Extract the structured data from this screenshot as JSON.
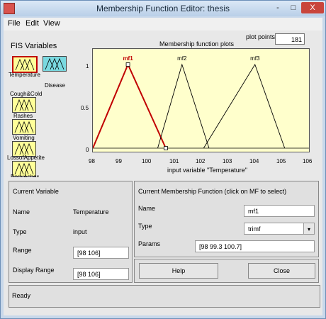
{
  "window": {
    "title": "Membership Function Editor: thesis",
    "minimize": "-",
    "maximize": "□",
    "close": "X"
  },
  "menu": [
    "File",
    "Edit",
    "View"
  ],
  "fis_variables": {
    "heading": "FIS Variables",
    "inputs": [
      "Temperature",
      "Cough&Cold",
      "Rashes",
      "Vomiting",
      "LossofAppetite",
      "BodyAches"
    ],
    "output": "Disease"
  },
  "plot": {
    "title": "Membership function plots",
    "plot_points_label": "plot points:",
    "plot_points_value": "181",
    "x_label": "input variable \"Temperature\"",
    "x_ticks": [
      "98",
      "99",
      "100",
      "101",
      "102",
      "103",
      "104",
      "105",
      "106"
    ],
    "y_ticks": [
      "1",
      "0.5",
      "0"
    ],
    "mf_labels": [
      "mf1",
      "mf2",
      "mf3"
    ],
    "colors": {
      "selected": "#c00000",
      "other": "#000000",
      "background": "#ffffcc"
    }
  },
  "chart_data": {
    "type": "line",
    "title": "Membership function plots",
    "xlabel": "input variable \"Temperature\"",
    "ylabel": "",
    "xlim": [
      98,
      106
    ],
    "ylim": [
      0,
      1
    ],
    "series": [
      {
        "name": "mf1",
        "x": [
          98,
          99.3,
          100.7
        ],
        "y": [
          0,
          1,
          0
        ]
      },
      {
        "name": "mf2",
        "x": [
          100.4,
          101.3,
          102.3
        ],
        "y": [
          0,
          1,
          0
        ]
      },
      {
        "name": "mf3",
        "x": [
          102.1,
          104,
          105.1
        ],
        "y": [
          0,
          1,
          0
        ]
      }
    ]
  },
  "current_variable": {
    "heading": "Current Variable",
    "name_label": "Name",
    "name_value": "Temperature",
    "type_label": "Type",
    "type_value": "input",
    "range_label": "Range",
    "range_value": "[98 106]",
    "display_range_label": "Display Range",
    "display_range_value": "[98 106]"
  },
  "current_mf": {
    "heading": "Current Membership Function (click on MF to select)",
    "name_label": "Name",
    "name_value": "mf1",
    "type_label": "Type",
    "type_value": "trimf",
    "params_label": "Params",
    "params_value": "[98 99.3 100.7]"
  },
  "buttons": {
    "help": "Help",
    "close": "Close"
  },
  "status": "Ready"
}
